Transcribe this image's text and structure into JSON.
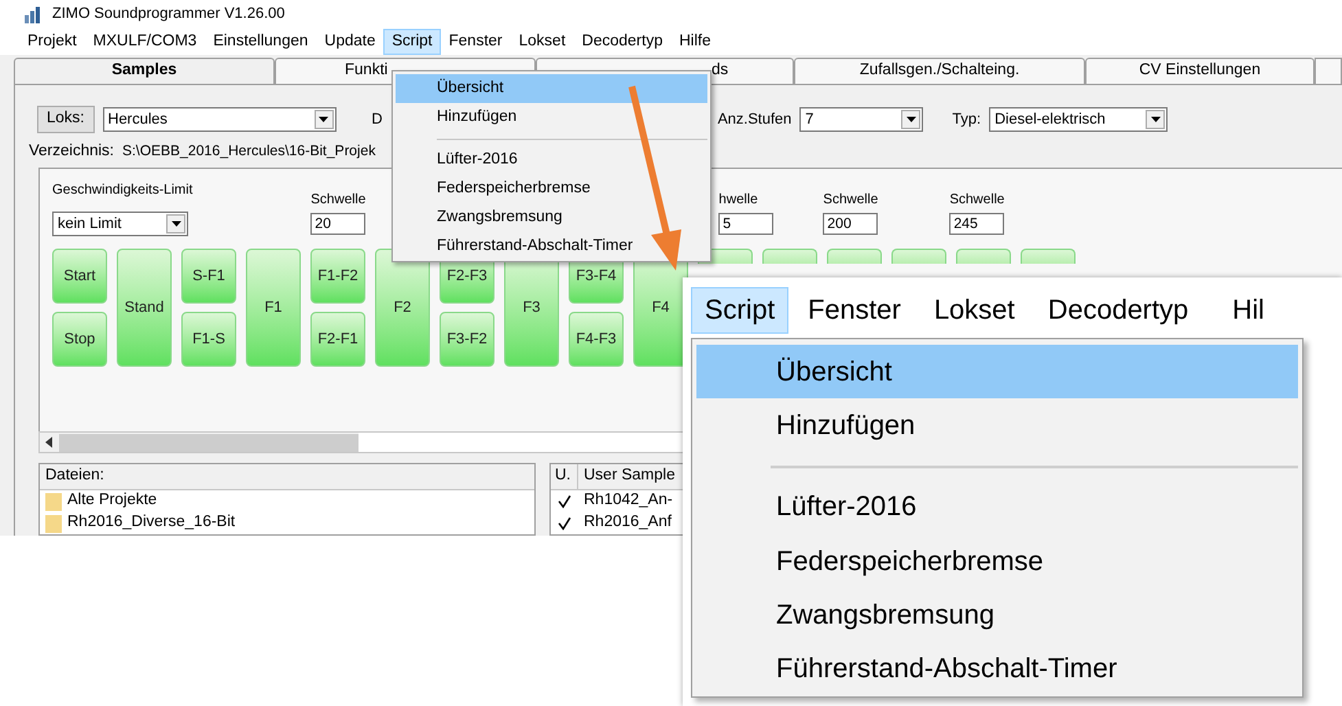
{
  "window": {
    "title": "ZIMO Soundprogrammer V1.26.00"
  },
  "menu_bar": [
    {
      "label": "Projekt",
      "selected": false
    },
    {
      "label": "MXULF/COM3",
      "selected": false
    },
    {
      "label": "Einstellungen",
      "selected": false
    },
    {
      "label": "Update",
      "selected": false
    },
    {
      "label": "Script",
      "selected": true
    },
    {
      "label": "Fenster",
      "selected": false
    },
    {
      "label": "Lokset",
      "selected": false
    },
    {
      "label": "Decodertyp",
      "selected": false
    },
    {
      "label": "Hilfe",
      "selected": false
    }
  ],
  "script_menu": [
    {
      "kind": "item",
      "label": "Übersicht",
      "selected": true
    },
    {
      "kind": "item",
      "label": "Hinzufügen",
      "selected": false
    },
    {
      "kind": "separator"
    },
    {
      "kind": "item",
      "label": "Lüfter-2016",
      "selected": false
    },
    {
      "kind": "item",
      "label": "Federspeicherbremse",
      "selected": false
    },
    {
      "kind": "item",
      "label": "Zwangsbremsung",
      "selected": false
    },
    {
      "kind": "item",
      "label": "Führerstand-Abschalt-Timer",
      "selected": false
    }
  ],
  "tabs": [
    {
      "label": "Samples",
      "selected": true
    },
    {
      "label": "Funkti",
      "selected": false
    },
    {
      "label": "ds",
      "selected": false
    },
    {
      "label": "Zufallsgen./Schalteing.",
      "selected": false
    },
    {
      "label": "CV Einstellungen",
      "selected": false
    }
  ],
  "loks": {
    "button": "Loks:",
    "value": "Hercules"
  },
  "label_d": "D",
  "stufen": {
    "label": "Anz.Stufen",
    "value": "7"
  },
  "typ": {
    "label": "Typ:",
    "value": "Diesel-elektrisch"
  },
  "directory": {
    "label": "Verzeichnis:",
    "path": "S:\\OEBB_2016_Hercules\\16-Bit_Projek"
  },
  "speed_limit": {
    "label": "Geschwindigkeits-Limit",
    "value": "kein Limit"
  },
  "thresholds": [
    {
      "label": "Schwelle",
      "value": "20"
    },
    {
      "label": "hwelle",
      "value": "5"
    },
    {
      "label": "Schwelle",
      "value": "200"
    },
    {
      "label": "Schwelle",
      "value": "245"
    }
  ],
  "step_buttons": [
    {
      "kind": "pair",
      "top": "Start",
      "bottom": "Stop"
    },
    {
      "kind": "single",
      "label": "Stand"
    },
    {
      "kind": "pair",
      "top": "S-F1",
      "bottom": "F1-S"
    },
    {
      "kind": "single",
      "label": "F1"
    },
    {
      "kind": "pair",
      "top": "F1-F2",
      "bottom": "F2-F1"
    },
    {
      "kind": "single",
      "label": "F2"
    },
    {
      "kind": "pair",
      "top": "F2-F3",
      "bottom": "F3-F2"
    },
    {
      "kind": "single",
      "label": "F3"
    },
    {
      "kind": "pair",
      "top": "F3-F4",
      "bottom": "F4-F3"
    },
    {
      "kind": "single",
      "label": "F4"
    }
  ],
  "files": {
    "header": "Dateien:",
    "items": [
      "Alte Projekte",
      "Rh2016_Diverse_16-Bit"
    ]
  },
  "user_samples": {
    "columns": [
      "U.",
      "User Sample"
    ],
    "rows": [
      {
        "checked": true,
        "name": "Rh1042_An-"
      },
      {
        "checked": true,
        "name": "Rh2016_Anf"
      }
    ]
  },
  "zoom_inset": {
    "menu_bar": [
      {
        "label": "Script",
        "selected": true
      },
      {
        "label": "Fenster",
        "selected": false
      },
      {
        "label": "Lokset",
        "selected": false
      },
      {
        "label": "Decodertyp",
        "selected": false
      },
      {
        "label": "Hil",
        "selected": false
      }
    ],
    "items": [
      {
        "kind": "item",
        "label": "Übersicht",
        "selected": true
      },
      {
        "kind": "item",
        "label": "Hinzufügen",
        "selected": false
      },
      {
        "kind": "separator"
      },
      {
        "kind": "item",
        "label": "Lüfter-2016",
        "selected": false
      },
      {
        "kind": "item",
        "label": "Federspeicherbremse",
        "selected": false
      },
      {
        "kind": "item",
        "label": "Zwangsbremsung",
        "selected": false
      },
      {
        "kind": "item",
        "label": "Führerstand-Abschalt-Timer",
        "selected": false
      }
    ]
  }
}
